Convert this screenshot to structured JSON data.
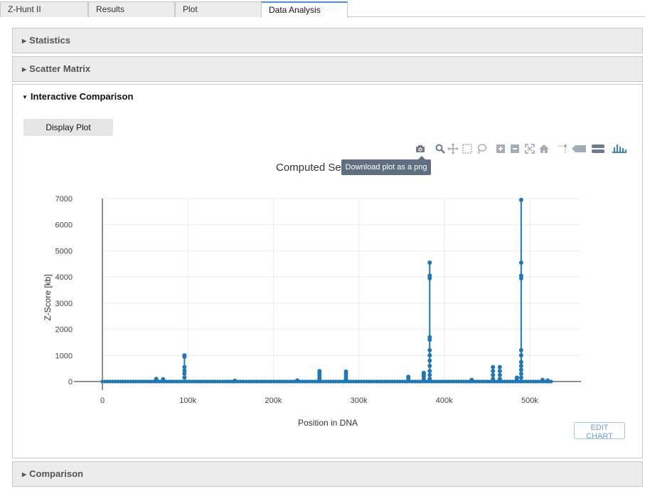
{
  "tabs": [
    {
      "label": "Z-Hunt II",
      "active": false
    },
    {
      "label": "Results",
      "active": false
    },
    {
      "label": "Plot",
      "active": false
    },
    {
      "label": "Data Analysis",
      "active": true
    }
  ],
  "panels": {
    "statistics": {
      "label": "Statistics",
      "expanded": false
    },
    "scatter_matrix": {
      "label": "Scatter Matrix",
      "expanded": false
    },
    "interactive_comparison": {
      "label": "Interactive Comparison",
      "expanded": true
    },
    "comparison": {
      "label": "Comparison",
      "expanded": false
    }
  },
  "interactive": {
    "display_plot_label": "Display Plot",
    "edit_chart_label": "EDIT CHART",
    "tooltip": "Download plot as a png",
    "modebar_icons": [
      "camera-icon",
      "zoom-icon",
      "pan-icon",
      "box-select-icon",
      "lasso-select-icon",
      "zoom-in-icon",
      "zoom-out-icon",
      "autoscale-icon",
      "reset-axes-icon",
      "spike-lines-icon",
      "hover-closest-icon",
      "hover-compare-icon",
      "plotly-logo-icon"
    ]
  },
  "chart_data": {
    "type": "line",
    "title": "Computed Se",
    "xlabel": "Position in DNA",
    "ylabel": "Z-Score [kb]",
    "xlim": [
      0,
      560000
    ],
    "ylim": [
      0,
      7000
    ],
    "xticks": [
      "0",
      "100k",
      "200k",
      "300k",
      "400k",
      "500k"
    ],
    "xtick_values": [
      0,
      100000,
      200000,
      300000,
      400000,
      500000
    ],
    "yticks": [
      "0",
      "1000",
      "2000",
      "3000",
      "4000",
      "5000",
      "6000",
      "7000"
    ],
    "ytick_values": [
      0,
      1000,
      2000,
      3000,
      4000,
      5000,
      6000,
      7000
    ],
    "color": "#1f77b4",
    "grid": true,
    "baseline": {
      "start": 0,
      "end": 525000,
      "value": 0
    },
    "spikes": [
      {
        "x": 63000,
        "values": [
          60,
          100
        ]
      },
      {
        "x": 71000,
        "values": [
          50,
          90
        ]
      },
      {
        "x": 96000,
        "values": [
          150,
          300,
          420,
          550,
          950,
          1000
        ]
      },
      {
        "x": 155000,
        "values": [
          30
        ]
      },
      {
        "x": 228000,
        "values": [
          40
        ]
      },
      {
        "x": 254000,
        "values": [
          80,
          150,
          250,
          350,
          400
        ]
      },
      {
        "x": 285000,
        "values": [
          100,
          200,
          300,
          380
        ]
      },
      {
        "x": 358000,
        "values": [
          100,
          180
        ]
      },
      {
        "x": 376000,
        "values": [
          100,
          200,
          250,
          300,
          330
        ]
      },
      {
        "x": 383000,
        "values": [
          100,
          250,
          400,
          600,
          800,
          1000,
          1200,
          1600,
          1700,
          3950,
          4050,
          4550
        ]
      },
      {
        "x": 432000,
        "values": [
          60
        ]
      },
      {
        "x": 457000,
        "values": [
          100,
          250,
          400,
          550
        ]
      },
      {
        "x": 465000,
        "values": [
          100,
          250,
          400,
          550
        ]
      },
      {
        "x": 485000,
        "values": [
          80,
          150
        ]
      },
      {
        "x": 490000,
        "values": [
          150,
          300,
          450,
          600,
          750,
          1000,
          1200,
          3950,
          4050,
          4550,
          6950
        ]
      },
      {
        "x": 515000,
        "values": [
          30,
          60
        ]
      },
      {
        "x": 521000,
        "values": [
          20,
          40
        ]
      }
    ]
  }
}
